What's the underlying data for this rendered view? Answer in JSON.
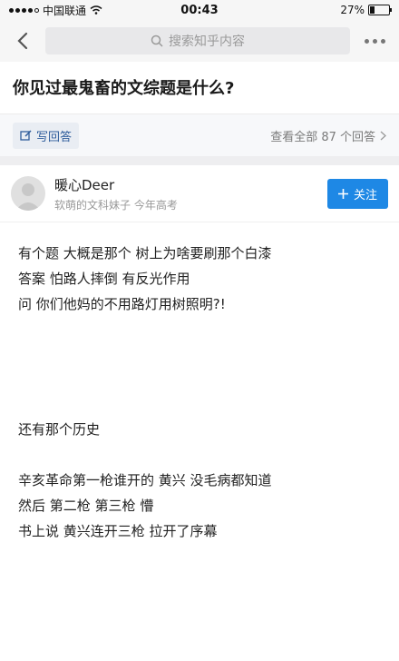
{
  "status_bar": {
    "carrier": "中国联通",
    "time": "00:43",
    "battery": "27%",
    "battery_level": 0.27
  },
  "nav": {
    "search_placeholder": "搜索知乎内容"
  },
  "question": {
    "title": "你见过最鬼畜的文综题是什么?",
    "write_answer_label": "写回答",
    "view_all_label": "查看全部 87 个回答"
  },
  "author": {
    "name": "暖心Deer",
    "bio": "软萌的文科妹子 今年高考",
    "follow_label": "关注"
  },
  "answer": {
    "paragraphs": [
      [
        "有个题 大概是那个 树上为啥要刷那个白漆",
        "答案 怕路人摔倒 有反光作用",
        "问 你们他妈的不用路灯用树照明?!"
      ],
      [
        "还有那个历史"
      ],
      [
        "辛亥革命第一枪谁开的 黄兴 没毛病都知道",
        "然后 第二枪 第三枪 懵",
        "书上说 黄兴连开三枪 拉开了序幕"
      ]
    ]
  }
}
